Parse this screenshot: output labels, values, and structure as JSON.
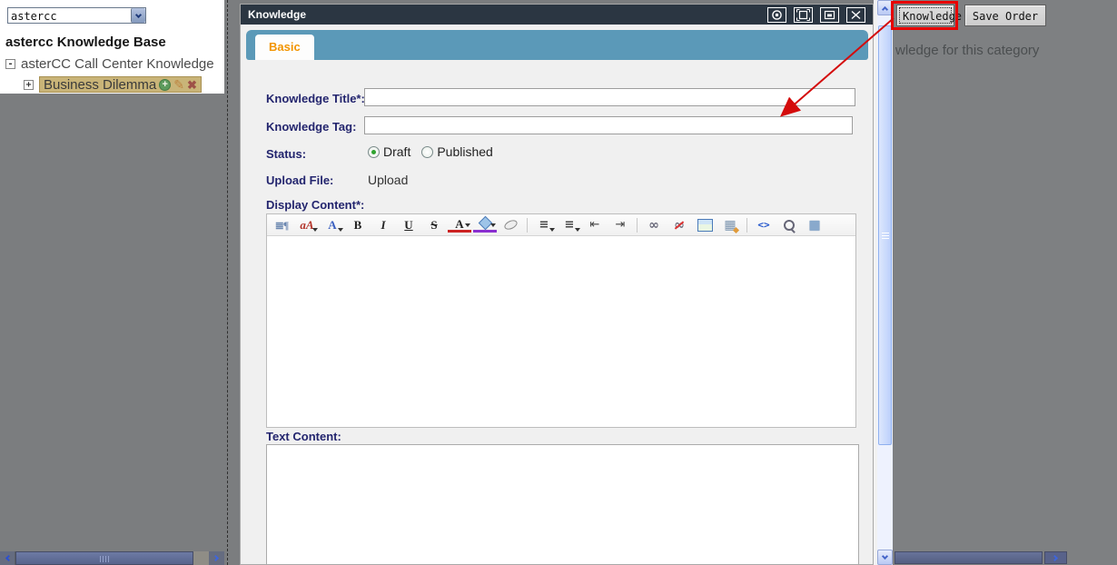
{
  "sidebar": {
    "category_select": {
      "value": "astercc"
    },
    "heading": "astercc Knowledge Base",
    "tree": {
      "root": {
        "toggle": "-",
        "label": "asterCC Call Center Knowledge"
      },
      "child": {
        "toggle": "+",
        "label": "Business Dilemma",
        "icons": {
          "add": "+",
          "edit": "✎",
          "delete": "✖"
        }
      }
    }
  },
  "dialog": {
    "title": "Knowledge",
    "window_icons": [
      "refresh-icon",
      "maximize-icon",
      "restore-icon",
      "close-icon"
    ],
    "active_tab": "Basic",
    "form": {
      "knowledge_title": {
        "label": "Knowledge Title*:",
        "value": "",
        "placeholder": ""
      },
      "knowledge_tag": {
        "label": "Knowledge Tag:",
        "value": "",
        "placeholder": ""
      },
      "status": {
        "label": "Status:",
        "options": [
          "Draft",
          "Published"
        ],
        "selected": "Draft"
      },
      "upload_file": {
        "label": "Upload File:",
        "action": "Upload"
      },
      "display_content": {
        "label": "Display Content*:",
        "value": ""
      },
      "text_content": {
        "label": "Text Content:",
        "value": ""
      }
    },
    "editor_toolbar": [
      {
        "name": "show-blocks-icon",
        "glyph": "≣¶",
        "cls": "g-showblocks"
      },
      {
        "name": "font-family-icon",
        "glyph": "aA",
        "cls": "g-font dd"
      },
      {
        "name": "font-size-icon",
        "glyph": "A",
        "cls": "g-size dd"
      },
      {
        "name": "bold-icon",
        "glyph": "B",
        "cls": ""
      },
      {
        "name": "italic-icon",
        "glyph": "I",
        "cls": "g-italic"
      },
      {
        "name": "underline-icon",
        "glyph": "U",
        "cls": "g-under"
      },
      {
        "name": "strikethrough-icon",
        "glyph": "S",
        "cls": "g-strike"
      },
      {
        "name": "text-color-icon",
        "glyph": "A",
        "cls": "g-tcolor dd"
      },
      {
        "name": "background-color-icon",
        "glyph": "",
        "cls": "g-bucket dd"
      },
      {
        "name": "remove-format-icon",
        "glyph": "",
        "cls": "g-eraser"
      },
      {
        "sep": true
      },
      {
        "name": "align-icon",
        "glyph": "≡",
        "cls": "g-lines dd"
      },
      {
        "name": "list-icon",
        "glyph": "≡",
        "cls": "g-lines dd"
      },
      {
        "name": "outdent-icon",
        "glyph": "⇤",
        "cls": "g-arrow"
      },
      {
        "name": "indent-icon",
        "glyph": "⇥",
        "cls": "g-arrow"
      },
      {
        "sep": true
      },
      {
        "name": "link-icon",
        "glyph": "∞",
        "cls": "g-link"
      },
      {
        "name": "unlink-icon",
        "glyph": "∞",
        "cls": "g-link g-unlink"
      },
      {
        "name": "image-icon",
        "glyph": "",
        "cls": "g-image"
      },
      {
        "name": "table-icon",
        "glyph": "▦",
        "cls": "g-table"
      },
      {
        "sep": true
      },
      {
        "name": "source-icon",
        "glyph": "<>",
        "cls": "g-source"
      },
      {
        "name": "preview-icon",
        "glyph": "",
        "cls": "g-preview"
      },
      {
        "name": "fullscreen-icon",
        "glyph": "■",
        "cls": "g-fullscr"
      }
    ]
  },
  "background_page": {
    "knowledge_button": "Knowledge",
    "save_order_button": "Save Order",
    "caption": "wledge for this category"
  },
  "colors": {
    "titlebar": "#2b3642",
    "tab_strip": "#5b99b8",
    "tab_text": "#f29400",
    "label_navy": "#23256e",
    "annotation_red": "#e80000",
    "tree_highlight": "#c9b478"
  }
}
